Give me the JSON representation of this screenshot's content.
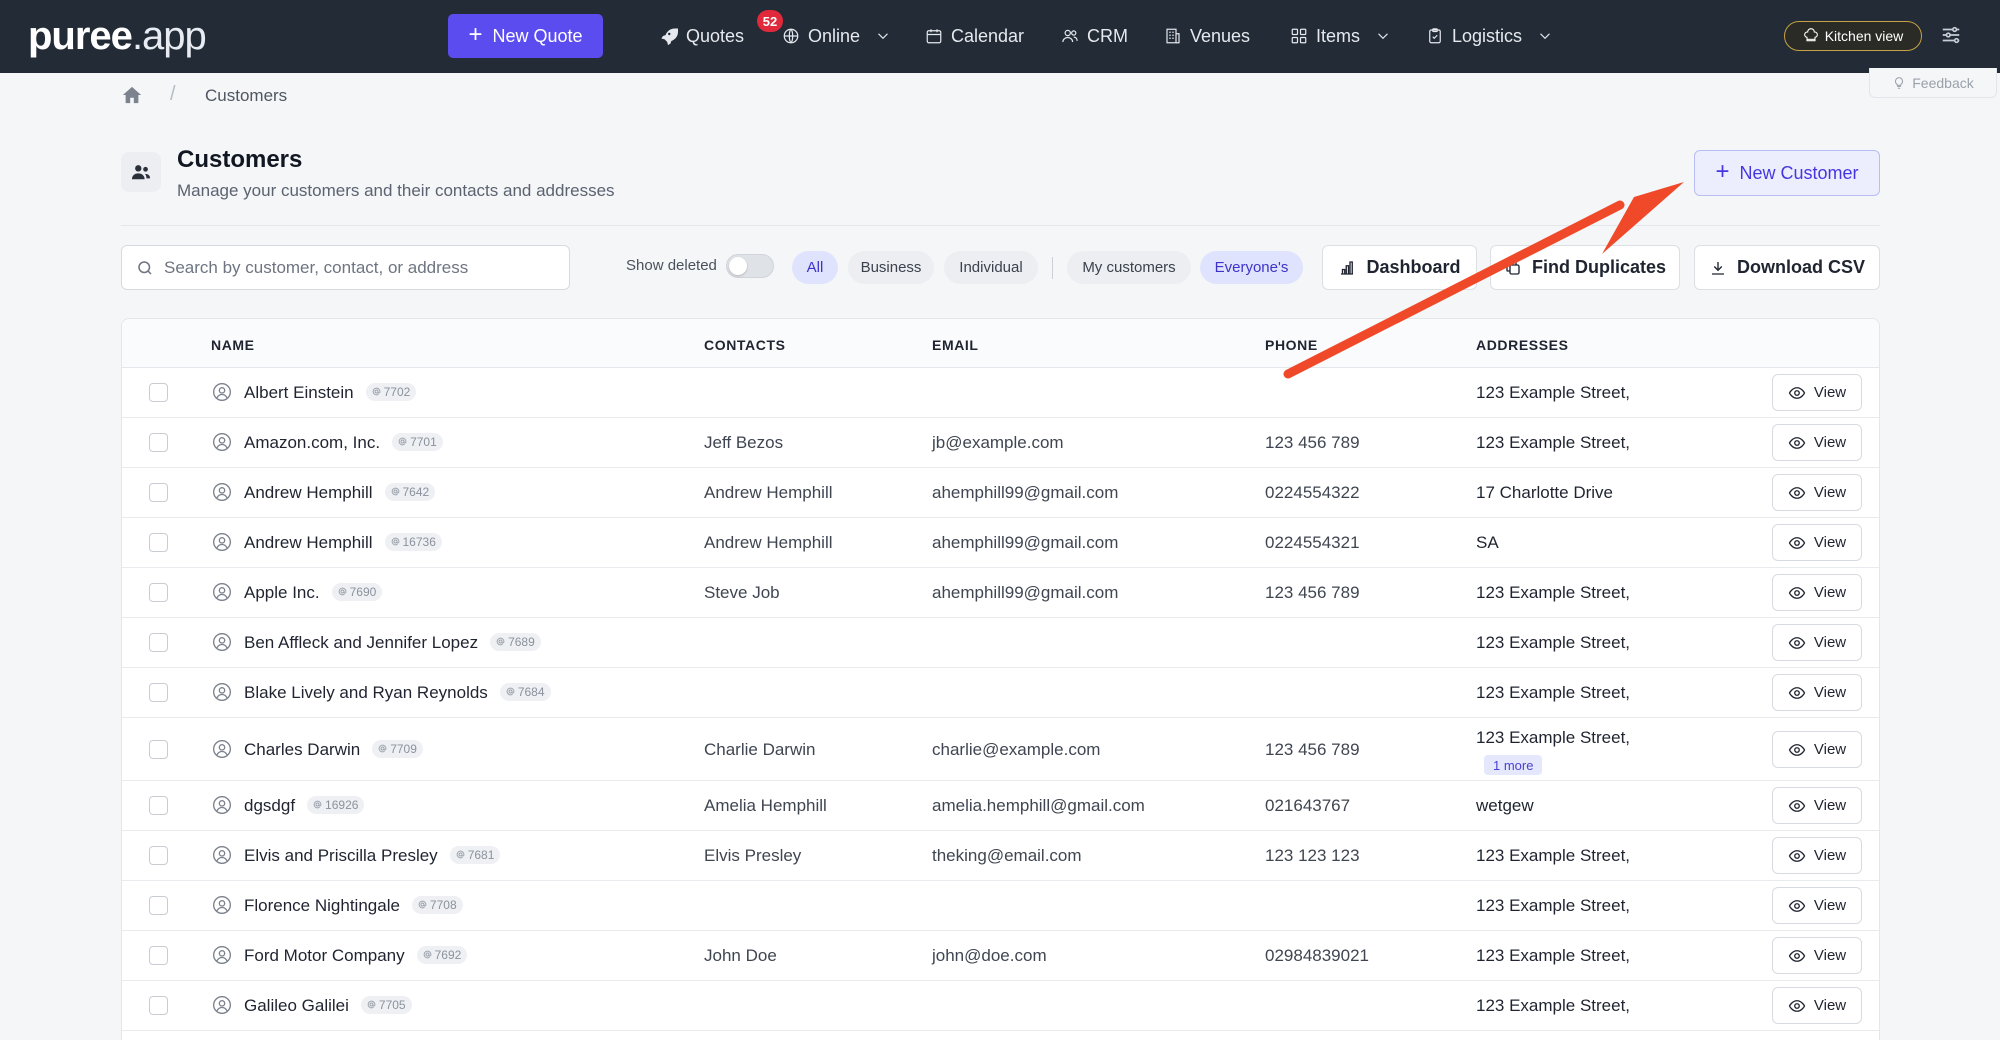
{
  "nav": {
    "logo_main": "puree",
    "logo_suffix": ".app",
    "new_quote": "New Quote",
    "quotes": "Quotes",
    "quotes_badge": "52",
    "online": "Online",
    "calendar": "Calendar",
    "crm": "CRM",
    "venues": "Venues",
    "items": "Items",
    "logistics": "Logistics",
    "kitchen_view": "Kitchen view"
  },
  "breadcrumb": {
    "current": "Customers",
    "separator": "/"
  },
  "feedback": "Feedback",
  "header": {
    "title": "Customers",
    "subtitle": "Manage your customers and their contacts and addresses",
    "new_customer": "New Customer"
  },
  "toolbar": {
    "search_placeholder": "Search by customer, contact, or address",
    "show_deleted": "Show deleted",
    "filters": [
      "All",
      "Business",
      "Individual"
    ],
    "owner_filters": [
      "My customers",
      "Everyone's"
    ],
    "dashboard": "Dashboard",
    "find_duplicates": "Find Duplicates",
    "download_csv": "Download CSV"
  },
  "table": {
    "columns": [
      "NAME",
      "CONTACTS",
      "EMAIL",
      "PHONE",
      "ADDRESSES"
    ],
    "view_label": "View",
    "rows": [
      {
        "name": "Albert Einstein",
        "id": "7702",
        "contact": "",
        "email": "",
        "phone": "",
        "address": "123 Example Street,",
        "more": ""
      },
      {
        "name": "Amazon.com, Inc.",
        "id": "7701",
        "contact": "Jeff Bezos",
        "email": "jb@example.com",
        "phone": "123 456 789",
        "address": "123 Example Street,",
        "more": ""
      },
      {
        "name": "Andrew Hemphill",
        "id": "7642",
        "contact": "Andrew Hemphill",
        "email": "ahemphill99@gmail.com",
        "phone": "0224554322",
        "address": "17 Charlotte Drive",
        "more": ""
      },
      {
        "name": "Andrew Hemphill",
        "id": "16736",
        "contact": "Andrew Hemphill",
        "email": "ahemphill99@gmail.com",
        "phone": "0224554321",
        "address": "SA",
        "more": ""
      },
      {
        "name": "Apple Inc.",
        "id": "7690",
        "contact": "Steve Job",
        "email": "ahemphill99@gmail.com",
        "phone": "123 456 789",
        "address": "123 Example Street,",
        "more": ""
      },
      {
        "name": "Ben Affleck and Jennifer Lopez",
        "id": "7689",
        "contact": "",
        "email": "",
        "phone": "",
        "address": "123 Example Street,",
        "more": ""
      },
      {
        "name": "Blake Lively and Ryan Reynolds",
        "id": "7684",
        "contact": "",
        "email": "",
        "phone": "",
        "address": "123 Example Street,",
        "more": ""
      },
      {
        "name": "Charles Darwin",
        "id": "7709",
        "contact": "Charlie Darwin",
        "email": "charlie@example.com",
        "phone": "123 456 789",
        "address": "123 Example Street,",
        "more": "1 more"
      },
      {
        "name": "dgsdgf",
        "id": "16926",
        "contact": "Amelia Hemphill",
        "email": "amelia.hemphill@gmail.com",
        "phone": "021643767",
        "address": "wetgew",
        "more": ""
      },
      {
        "name": "Elvis and Priscilla Presley",
        "id": "7681",
        "contact": "Elvis Presley",
        "email": "theking@email.com",
        "phone": "123 123 123",
        "address": "123 Example Street,",
        "more": ""
      },
      {
        "name": "Florence Nightingale",
        "id": "7708",
        "contact": "",
        "email": "",
        "phone": "",
        "address": "123 Example Street,",
        "more": ""
      },
      {
        "name": "Ford Motor Company",
        "id": "7692",
        "contact": "John Doe",
        "email": "john@doe.com",
        "phone": "02984839021",
        "address": "123 Example Street,",
        "more": ""
      },
      {
        "name": "Galileo Galilei",
        "id": "7705",
        "contact": "",
        "email": "",
        "phone": "",
        "address": "123 Example Street,",
        "more": ""
      }
    ]
  },
  "colors": {
    "nav_bg": "#222b36",
    "primary": "#5b4cf0",
    "badge": "#e0293b",
    "annotation_arrow": "#f0492a"
  }
}
